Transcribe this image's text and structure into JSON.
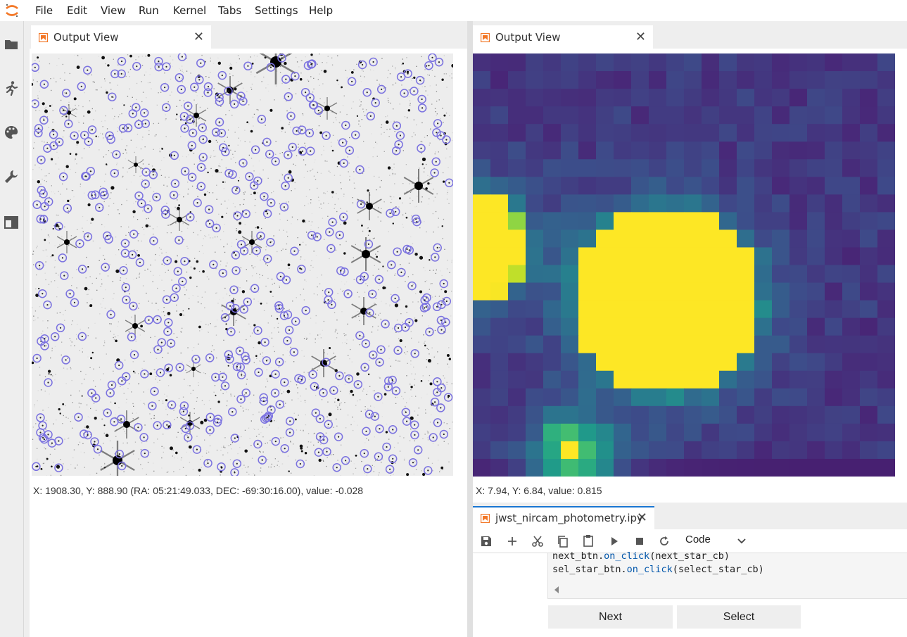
{
  "menubar": {
    "items": [
      "File",
      "Edit",
      "View",
      "Run",
      "Kernel",
      "Tabs",
      "Settings",
      "Help"
    ]
  },
  "sidebar": {
    "icons": [
      "folder-icon",
      "running-icon",
      "palette-icon",
      "wrench-icon",
      "tabs-icon"
    ]
  },
  "left_panel": {
    "tab_label": "Output View",
    "readout": "X: 1908.30, Y: 888.90 (RA: 05:21:49.033, DEC: -69:30:16.00), value: -0.028"
  },
  "right_panel": {
    "tab_label": "Output View",
    "readout": "X: 7.94, Y: 6.84, value: 0.815"
  },
  "notebook": {
    "tab_label": "jwst_nircam_photometry.ipy",
    "cell_type": "Code",
    "code_lines": [
      [
        {
          "t": "next_btn."
        },
        {
          "t": "on_click",
          "cls": "fn"
        },
        {
          "t": "(next_star_cb)"
        }
      ],
      [
        {
          "t": "sel_star_btn."
        },
        {
          "t": "on_click",
          "cls": "fn"
        },
        {
          "t": "(select_star_cb)"
        }
      ]
    ],
    "next_button": "Next",
    "select_button": "Select"
  },
  "colors": {
    "accent_orange": "#f37726",
    "viridis_low": "#46327e",
    "viridis_high": "#fde725",
    "circle_blue": "#7b72e0"
  }
}
